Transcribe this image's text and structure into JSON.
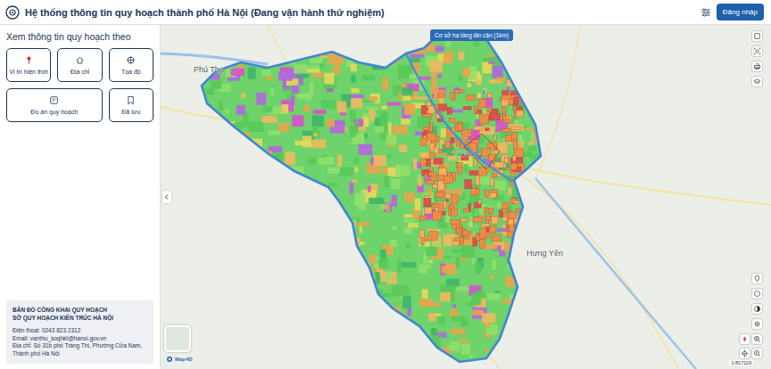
{
  "header": {
    "title": "Hệ thống thông tin quy hoạch thành phố Hà Nội (Đang vận hành thử nghiệm)",
    "login_button": "Đăng nhập"
  },
  "sidebar": {
    "heading": "Xem thông tin quy hoạch theo",
    "options": [
      {
        "label": "Vị trí hiện thời"
      },
      {
        "label": "Địa chỉ"
      },
      {
        "label": "Tọa độ"
      },
      {
        "label": "Đồ án quy hoạch"
      },
      {
        "label": "Đã lưu"
      }
    ],
    "contact": {
      "title": "BẢN ĐỒ CÔNG KHAI QUY HOẠCH",
      "org": "SỞ QUY HOẠCH KIẾN TRÚC HÀ NỘI",
      "lines": [
        "Điện thoại: 0243 823 2312",
        "Email: vanthu_soqhkt@hanoi.gov.vn",
        "Địa chỉ: Số 31b phố Tràng Thi, Phường Cửa Nam, Thành phố Hà Nội"
      ]
    }
  },
  "map": {
    "overlay_button": "Cơ sở hạ tầng lân cận (1km)",
    "labels": [
      {
        "text": "Phú Thọ"
      },
      {
        "text": "Hưng Yên"
      },
      {
        "text": "Hà Nội"
      }
    ],
    "attribution": "Map4D",
    "scale": "1:817119"
  }
}
